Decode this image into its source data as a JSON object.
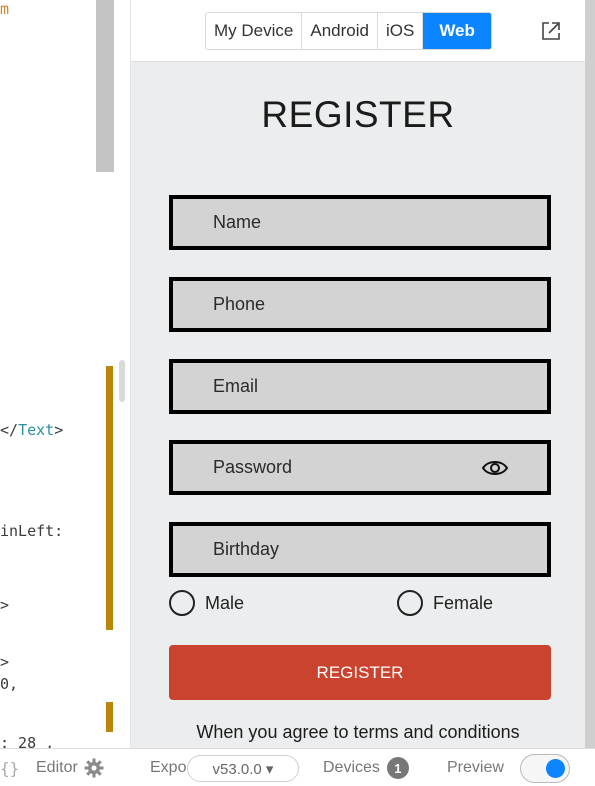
{
  "editor": {
    "lines": [
      {
        "text": "m",
        "color": "#d9822b"
      },
      {
        "close_tag_open": "</",
        "tag": "Text",
        "close_tag_close": ">"
      },
      {
        "text": "inLeft:"
      },
      {
        "text": ">"
      },
      {
        "text": ">"
      },
      {
        "text": "0,",
        "color": "#d9822b"
      },
      {
        "text": ": 28 ,"
      }
    ]
  },
  "preview": {
    "platform_tabs": [
      {
        "label": "My Device"
      },
      {
        "label": "Android"
      },
      {
        "label": "iOS"
      },
      {
        "label": "Web",
        "active": true
      }
    ],
    "external_icon": "external-link-icon",
    "title": "REGISTER",
    "fields": {
      "name": {
        "placeholder": "Name"
      },
      "phone": {
        "placeholder": "Phone"
      },
      "email": {
        "placeholder": "Email"
      },
      "password": {
        "placeholder": "Password",
        "icon": "eye-icon"
      },
      "birthday": {
        "placeholder": "Birthday"
      }
    },
    "gender": {
      "male": "Male",
      "female": "Female"
    },
    "register_button": "REGISTER",
    "terms": "When you agree to terms and conditions",
    "accent_color": "#0a84ff",
    "button_color": "#c9432f"
  },
  "statusbar": {
    "braces": "{}",
    "editor_label": "Editor",
    "gear_icon": "gear-icon",
    "expo_label": "Expo",
    "version": "v53.0.0 ▾",
    "devices_label": "Devices",
    "devices_count": "1",
    "preview_label": "Preview",
    "preview_enabled": true
  }
}
